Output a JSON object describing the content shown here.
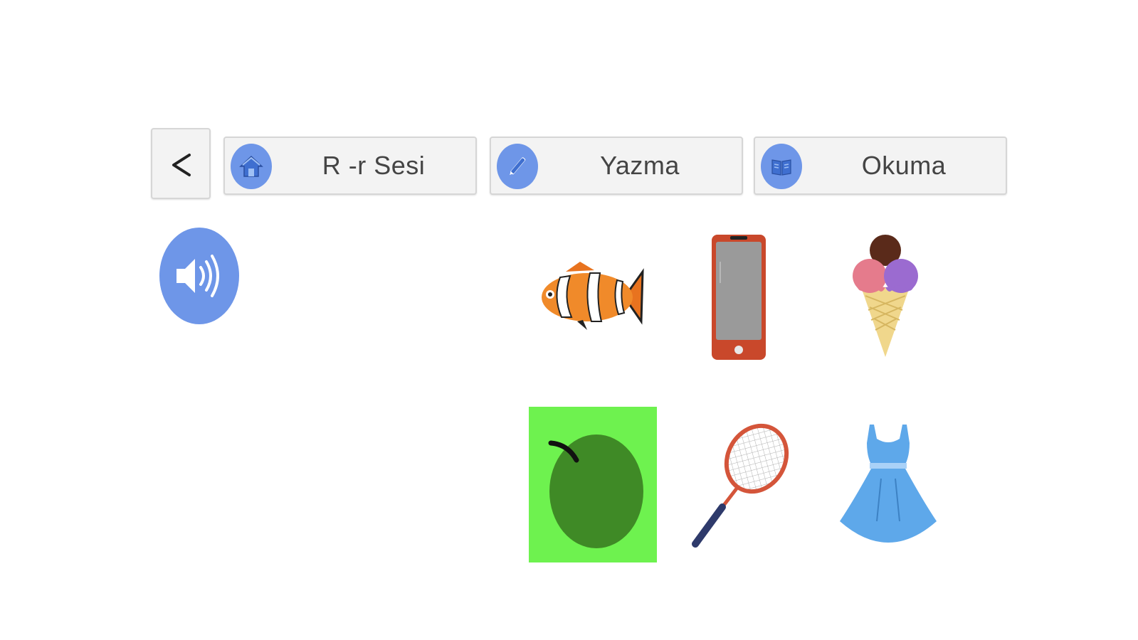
{
  "nav": {
    "back_icon": "chevron-left-icon",
    "buttons": [
      {
        "label": "R -r Sesi",
        "icon": "home-icon"
      },
      {
        "label": "Yazma",
        "icon": "pencil-icon"
      },
      {
        "label": "Okuma",
        "icon": "book-icon"
      }
    ]
  },
  "audio": {
    "icon": "speaker-icon"
  },
  "choices": [
    {
      "icon": "clownfish-icon"
    },
    {
      "icon": "smartphone-icon"
    },
    {
      "icon": "ice-cream-cone-icon"
    },
    {
      "icon": "green-fruit-icon",
      "selected": true
    },
    {
      "icon": "tennis-racket-icon"
    },
    {
      "icon": "dress-icon"
    }
  ],
  "colors": {
    "accent": "#6e96e8",
    "selected_bg": "#6ef24f",
    "button_bg": "#f3f3f3",
    "text": "#444444"
  }
}
